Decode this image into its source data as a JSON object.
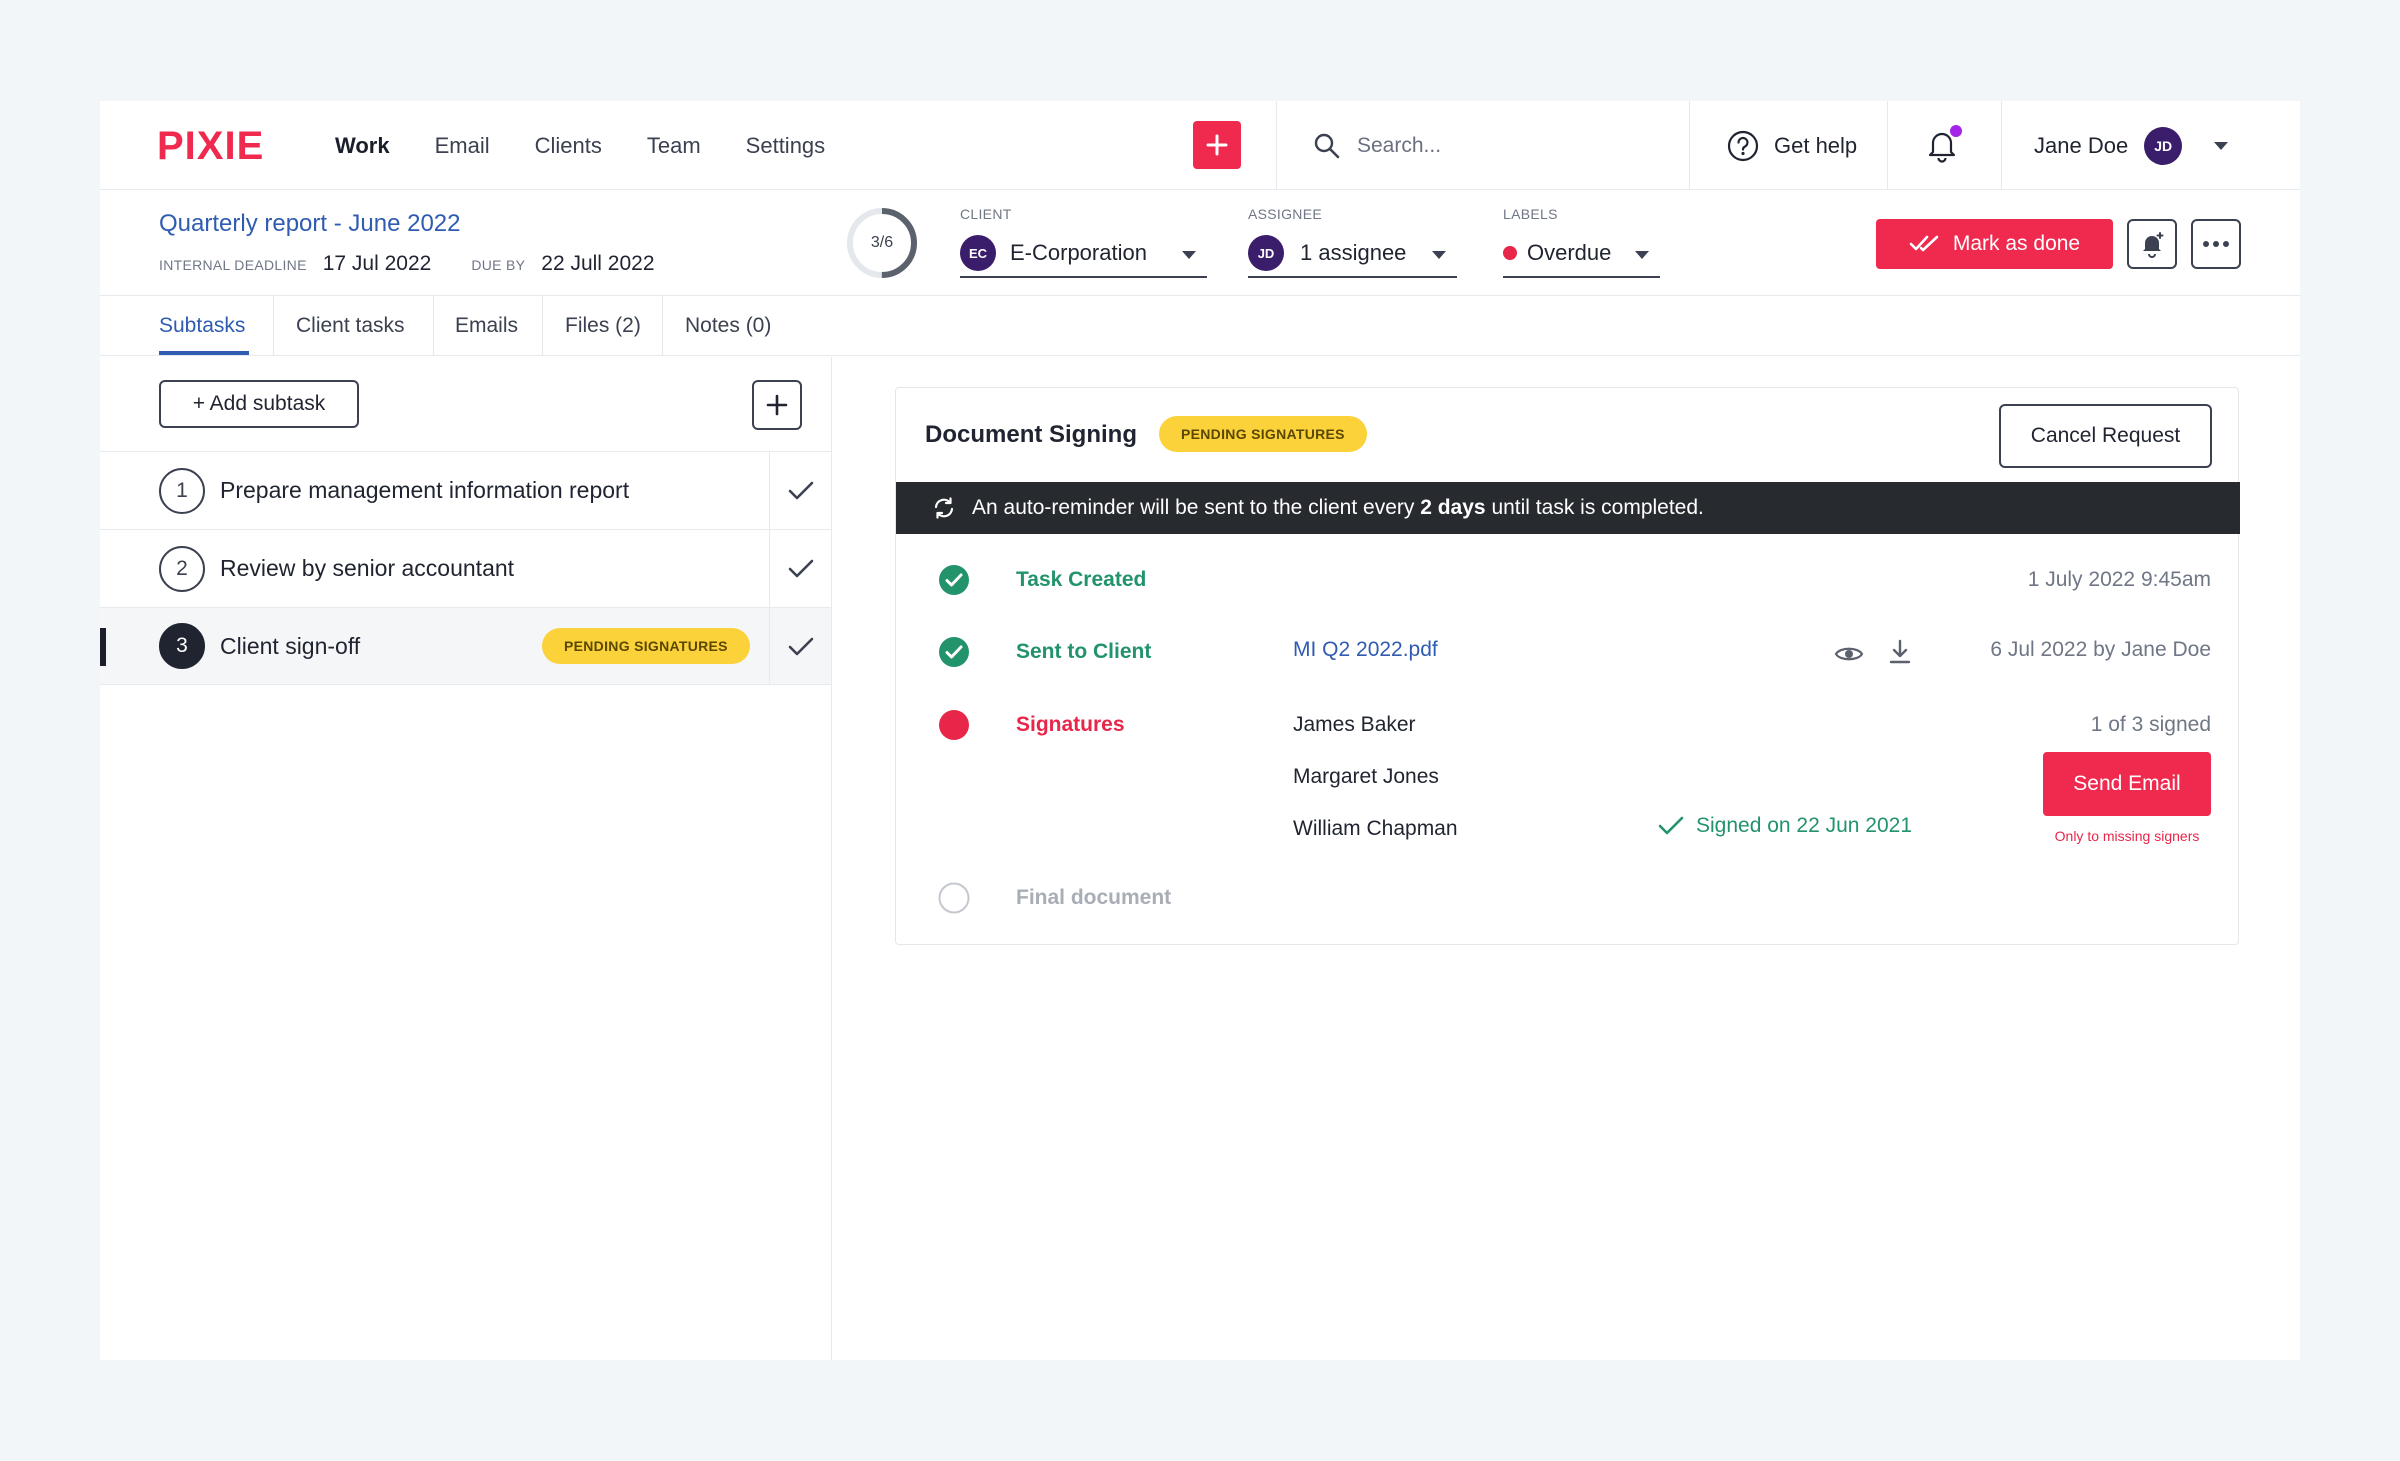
{
  "brand": {
    "name": "PIXIE",
    "color": "#f0294f"
  },
  "nav": {
    "items": [
      {
        "label": "Work",
        "active": true
      },
      {
        "label": "Email",
        "active": false
      },
      {
        "label": "Clients",
        "active": false
      },
      {
        "label": "Team",
        "active": false
      },
      {
        "label": "Settings",
        "active": false
      }
    ]
  },
  "header": {
    "add_icon": "plus-icon",
    "search": {
      "placeholder": "Search...",
      "value": ""
    },
    "help_label": "Get help",
    "notifications": {
      "icon": "bell-icon",
      "has_unread": true
    },
    "user": {
      "name": "Jane Doe",
      "initials": "JD"
    }
  },
  "task": {
    "title": "Quarterly report -  June 2022",
    "internal_deadline_label": "INTERNAL DEADLINE",
    "internal_deadline": "17 Jul 2022",
    "due_by_label": "DUE BY",
    "due_by": "22 Jull 2022",
    "progress": {
      "text": "3/6",
      "done": 3,
      "total": 6
    },
    "client": {
      "label": "CLIENT",
      "initials": "EC",
      "value": "E-Corporation"
    },
    "assignee": {
      "label": "ASSIGNEE",
      "initials": "JD",
      "value": "1 assignee"
    },
    "labels": {
      "label": "LABELS",
      "value": "Overdue",
      "color": "#e8264a"
    },
    "mark_done_label": "Mark as done"
  },
  "tabs": [
    {
      "label": "Subtasks",
      "active": true
    },
    {
      "label": "Client tasks",
      "active": false
    },
    {
      "label": "Emails",
      "active": false
    },
    {
      "label": "Files (2)",
      "active": false
    },
    {
      "label": "Notes (0)",
      "active": false
    }
  ],
  "subtasks": {
    "add_label": "+ Add subtask",
    "items": [
      {
        "number": "1",
        "label": "Prepare management information report",
        "badge": ""
      },
      {
        "number": "2",
        "label": "Review by senior accountant",
        "badge": ""
      },
      {
        "number": "3",
        "label": "Client sign-off",
        "badge": "PENDING SIGNATURES",
        "selected": true
      }
    ]
  },
  "signing": {
    "title": "Document Signing",
    "status_badge": "PENDING SIGNATURES",
    "cancel_label": "Cancel Request",
    "notice_pre": "An auto-reminder will be sent to the client every ",
    "notice_bold": "2 days",
    "notice_post": " until task is completed.",
    "steps": {
      "created": {
        "name": "Task Created",
        "meta": "1 July 2022  9:45am"
      },
      "sent": {
        "name": "Sent to Client",
        "file": "MI Q2 2022.pdf",
        "meta": "6 Jul 2022 by Jane Doe"
      },
      "signatures": {
        "name": "Signatures",
        "summary": "1 of 3 signed",
        "signers": [
          "James Baker",
          "Margaret Jones",
          "William Chapman"
        ],
        "signed_note": "Signed on 22 Jun 2021",
        "send_label": "Send Email",
        "send_note": "Only to missing signers"
      },
      "final": {
        "name": "Final document"
      }
    }
  },
  "colors": {
    "accent": "#f0294f",
    "link": "#2f5bb1",
    "success": "#23936b",
    "badge": "#fbd23a",
    "dark": "#272a2f"
  }
}
